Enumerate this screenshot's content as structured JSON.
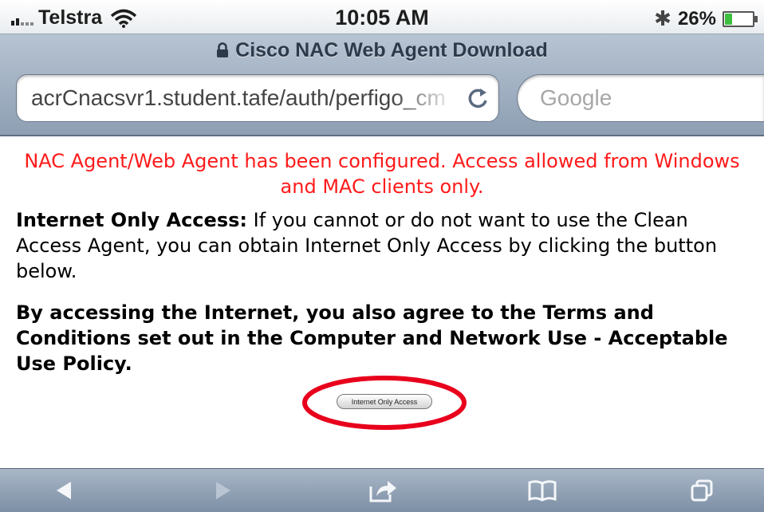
{
  "status_bar": {
    "carrier": "Telstra",
    "time": "10:05 AM",
    "battery_percent": "26%",
    "battery_level": 0.26,
    "icons": [
      "signal-icon",
      "wifi-icon",
      "bluetooth-icon",
      "battery-icon"
    ]
  },
  "browser": {
    "page_title": "Cisco NAC Web Agent Download",
    "url": "acrCnacsvr1.student.tafe/auth/perfigo_cm",
    "search_placeholder": "Google"
  },
  "page": {
    "notice": "NAC Agent/Web Agent has been configured. Access allowed from Windows and MAC clients only.",
    "internet_only_heading": "Internet Only Access:",
    "internet_only_text": " If you cannot or do not want to use the Clean Access Agent, you can obtain Internet Only Access by clicking the button below.",
    "agreement": "By accessing the Internet, you also agree to the Terms and Conditions set out in the Computer and Network Use - Acceptable Use Policy.",
    "button_label": "Internet Only Access"
  },
  "colors": {
    "notice_text": "#ff1a1a",
    "highlight_ellipse": "#e8001c",
    "chrome_bar": "#a3b3c5"
  },
  "toolbar": {
    "icons": [
      "back-icon",
      "forward-icon",
      "share-icon",
      "bookmarks-icon",
      "tabs-icon"
    ]
  }
}
